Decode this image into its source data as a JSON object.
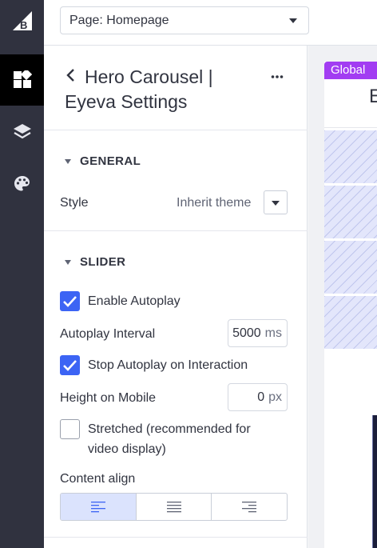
{
  "app": {
    "logo_letter": "B"
  },
  "rail": {
    "items": [
      {
        "icon": "widgets-icon",
        "active": true
      },
      {
        "icon": "layers-icon",
        "active": false
      },
      {
        "icon": "palette-icon",
        "active": false
      }
    ]
  },
  "topbar": {
    "page_select": "Page: Homepage"
  },
  "panel": {
    "title": "Hero Carousel | Eyeva Settings",
    "general": {
      "heading": "GENERAL",
      "style_label": "Style",
      "style_value": "Inherit theme"
    },
    "slider": {
      "heading": "SLIDER",
      "enable_autoplay": {
        "label": "Enable Autoplay",
        "checked": true
      },
      "autoplay_interval": {
        "label": "Autoplay Interval",
        "value": "5000",
        "unit": "ms"
      },
      "stop_autoplay": {
        "label": "Stop Autoplay on Interaction",
        "checked": true
      },
      "height_mobile": {
        "label": "Height on Mobile",
        "value": "0",
        "unit": "px"
      },
      "stretched": {
        "label": "Stretched (recommended for video display)",
        "checked": false
      },
      "content_align": {
        "label": "Content align",
        "options": [
          "left",
          "center",
          "right"
        ],
        "selected": "left"
      }
    }
  },
  "preview": {
    "tag": "Global",
    "letter": "E"
  },
  "colors": {
    "accent": "#3c64f4",
    "rail": "#30323f",
    "global_tag": "#a23df2",
    "selected_align": "#dbe3fd"
  }
}
